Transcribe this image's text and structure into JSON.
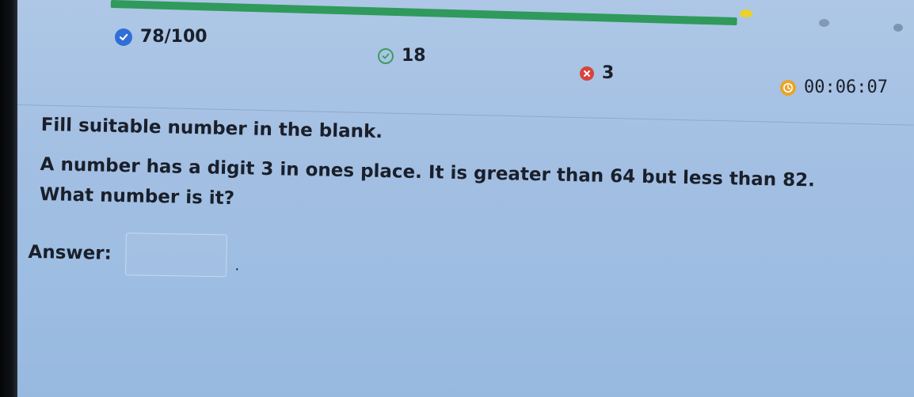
{
  "progress": {
    "fraction": 0.78,
    "color": "#2f9a5c"
  },
  "stats": {
    "score": {
      "icon": "check-filled-icon",
      "text": "78/100"
    },
    "correct": {
      "icon": "check-outline-icon",
      "text": "18"
    },
    "wrong": {
      "icon": "x-icon",
      "text": "3"
    },
    "timer": {
      "icon": "clock-icon",
      "text": "00:06:07"
    }
  },
  "question": {
    "instruction": "Fill suitable number in the blank.",
    "line1": "A number has a digit 3 in ones place. It is greater than 64 but less than 82.",
    "line2": "What number is it?"
  },
  "answer": {
    "label": "Answer:",
    "value": "",
    "trailing": "."
  },
  "colors": {
    "accent": "#2f6fd6",
    "correct": "#3c9c5e",
    "wrong": "#d8433a",
    "timer": "#e8a52b"
  }
}
